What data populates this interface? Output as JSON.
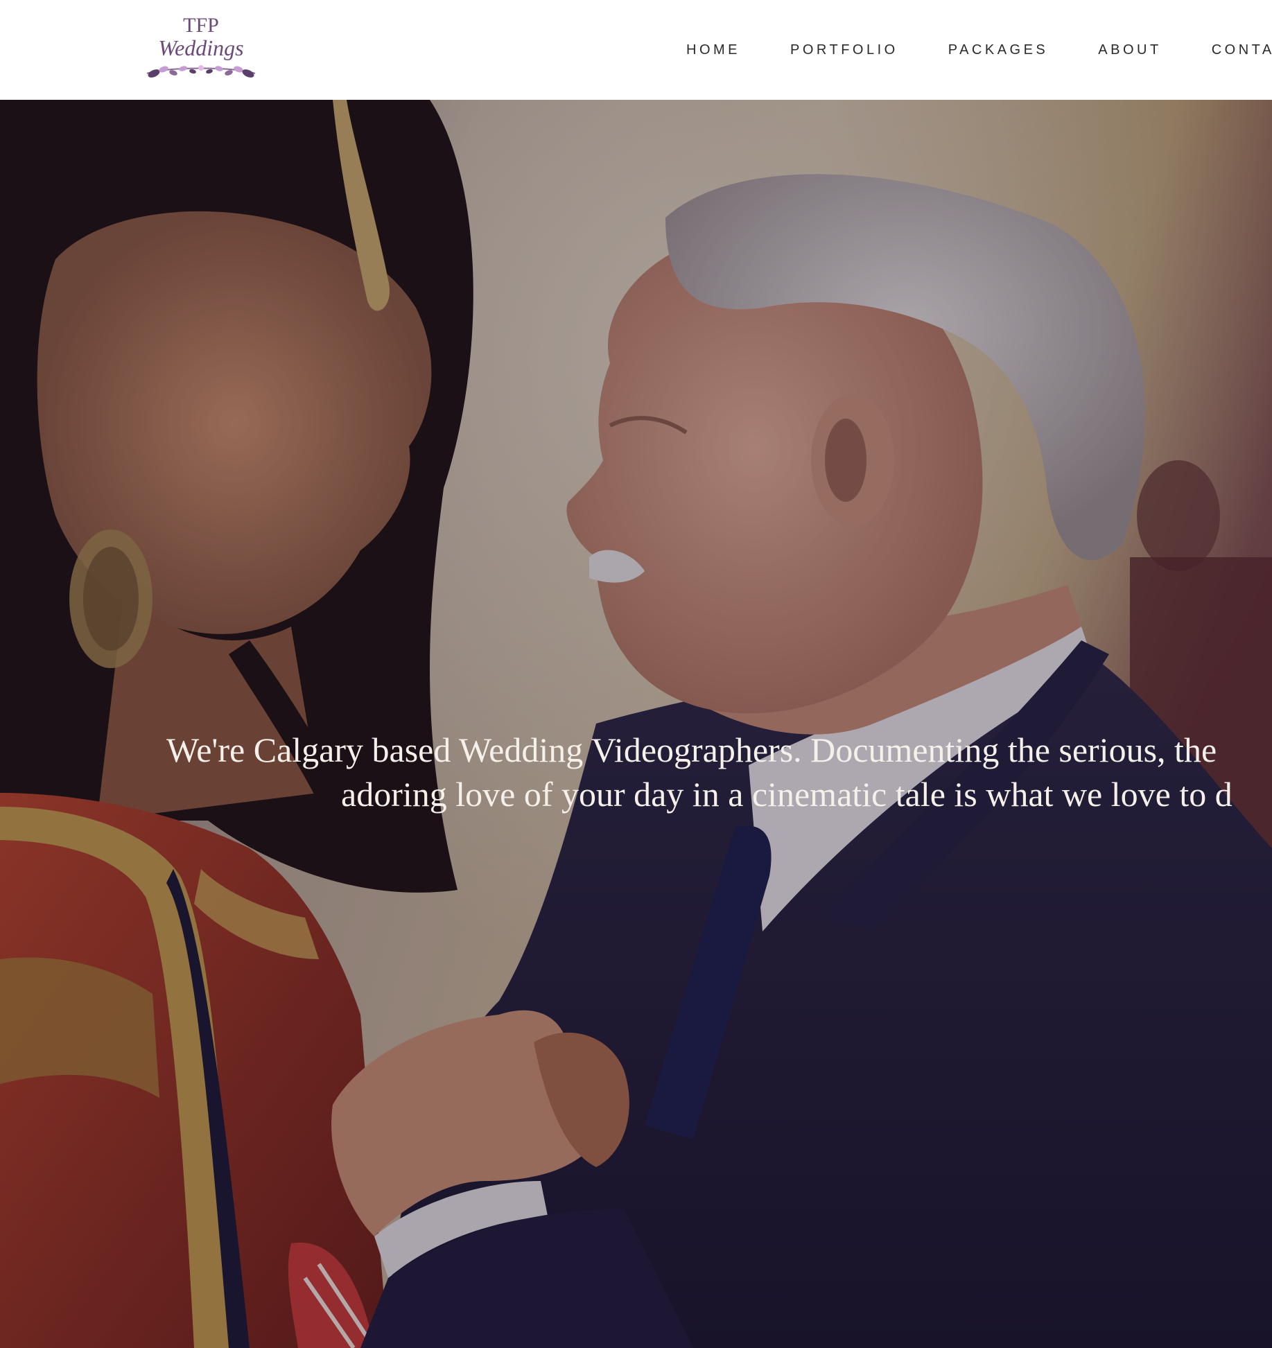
{
  "header": {
    "logo": {
      "line1": "TFP",
      "line2": "Weddings",
      "icon": "floral-laurel-icon"
    },
    "nav": [
      {
        "label": "HOME"
      },
      {
        "label": "PORTFOLIO"
      },
      {
        "label": "PACKAGES"
      },
      {
        "label": "ABOUT"
      },
      {
        "label": "CONTACT"
      }
    ]
  },
  "hero": {
    "tagline_line1": "We're Calgary based Wedding Videographers. Documenting the serious, the",
    "tagline_line2": "adoring love of your day in a cinematic tale is what we love to d"
  },
  "colors": {
    "logo_purple": "#6b4a7a",
    "logo_lavender": "#c79bd3",
    "nav_text": "#2a2a2a",
    "hero_text": "#f5f0ea"
  }
}
